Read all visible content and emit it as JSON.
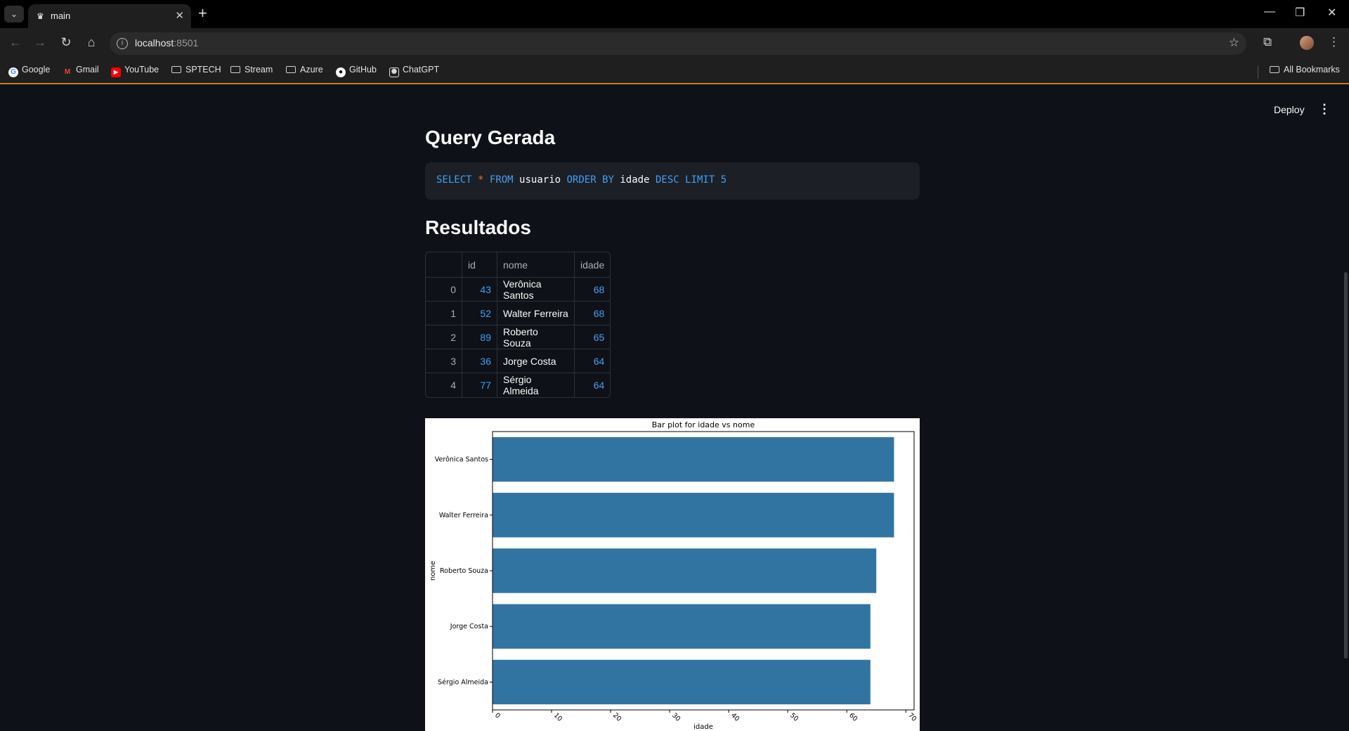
{
  "browser": {
    "tab_title": "main",
    "url_host": "localhost",
    "url_port": ":8501",
    "bookmarks": [
      "Google",
      "Gmail",
      "YouTube",
      "SPTECH",
      "Stream",
      "Azure",
      "GitHub",
      "ChatGPT"
    ],
    "all_bookmarks": "All Bookmarks"
  },
  "app": {
    "deploy_label": "Deploy",
    "query_heading": "Query Gerada",
    "query_tokens": {
      "t1": "SELECT",
      "t2": "*",
      "t3": "FROM",
      "t4": "usuario",
      "t5": "ORDER BY",
      "t6": "idade",
      "t7": "DESC",
      "t8": "LIMIT",
      "t9": "5"
    },
    "results_heading": "Resultados",
    "table": {
      "columns": [
        "",
        "id",
        "nome",
        "idade"
      ],
      "rows": [
        {
          "index": "0",
          "id": "43",
          "nome": "Verônica Santos",
          "idade": "68"
        },
        {
          "index": "1",
          "id": "52",
          "nome": "Walter Ferreira",
          "idade": "68"
        },
        {
          "index": "2",
          "id": "89",
          "nome": "Roberto Souza",
          "idade": "65"
        },
        {
          "index": "3",
          "id": "36",
          "nome": "Jorge Costa",
          "idade": "64"
        },
        {
          "index": "4",
          "id": "77",
          "nome": "Sérgio Almeida",
          "idade": "64"
        }
      ]
    }
  },
  "chart_data": {
    "type": "bar",
    "orientation": "horizontal",
    "title": "Bar plot for idade vs nome",
    "xlabel": "idade",
    "ylabel": "nome",
    "categories": [
      "Verônica Santos",
      "Walter Ferreira",
      "Roberto Souza",
      "Jorge Costa",
      "Sérgio Almeida"
    ],
    "values": [
      68,
      68,
      65,
      64,
      64
    ],
    "xlim": [
      0,
      71.4
    ],
    "xticks": [
      "0",
      "10",
      "20",
      "30",
      "40",
      "50",
      "60",
      "70"
    ],
    "bar_color": "#3274a1",
    "grid": false
  }
}
